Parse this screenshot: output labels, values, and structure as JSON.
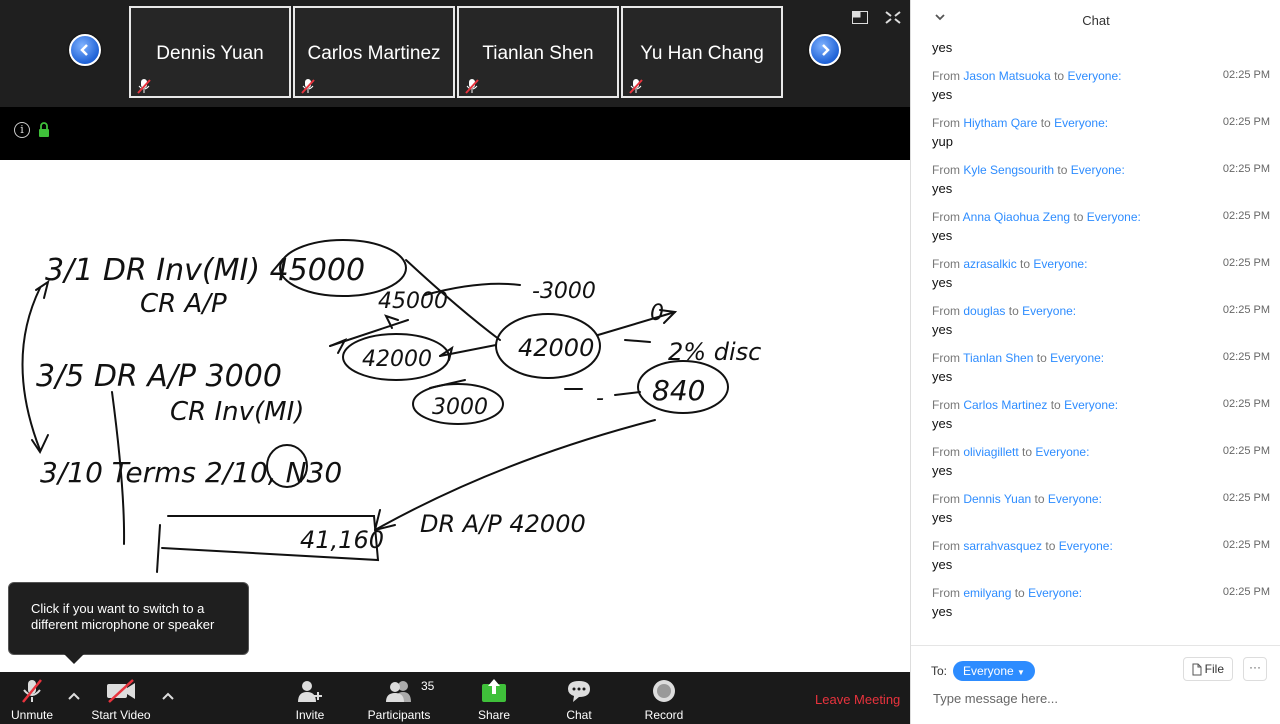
{
  "gallery": {
    "tiles": [
      {
        "name": "Dennis Yuan"
      },
      {
        "name": "Carlos Martinez"
      },
      {
        "name": "Tianlan Shen"
      },
      {
        "name": "Yu Han Chang"
      }
    ]
  },
  "tooltip": {
    "text": "Click if you want to switch to a different microphone or speaker"
  },
  "toolbar": {
    "unmute": "Unmute",
    "start_video": "Start Video",
    "invite": "Invite",
    "participants": "Participants",
    "participants_count": "35",
    "share": "Share",
    "chat": "Chat",
    "record": "Record",
    "leave": "Leave Meeting",
    "colors": {
      "share_green": "#3fc03a",
      "leave_red": "#e8333d",
      "mute_red": "#e8333d"
    }
  },
  "chat": {
    "title": "Chat",
    "first_message": "yes",
    "from_word": "From",
    "to_word": "to",
    "messages": [
      {
        "from": "Jason Matsuoka",
        "to": "Everyone:",
        "time": "02:25 PM",
        "text": "yes"
      },
      {
        "from": "Hiytham Qare",
        "to": "Everyone:",
        "time": "02:25 PM",
        "text": "yup"
      },
      {
        "from": "Kyle Sengsourith",
        "to": "Everyone:",
        "time": "02:25 PM",
        "text": "yes"
      },
      {
        "from": "Anna Qiaohua Zeng",
        "to": "Everyone:",
        "time": "02:25 PM",
        "text": "yes"
      },
      {
        "from": "azrasalkic",
        "to": "Everyone:",
        "time": "02:25 PM",
        "text": "yes"
      },
      {
        "from": "douglas",
        "to": "Everyone:",
        "time": "02:25 PM",
        "text": "yes"
      },
      {
        "from": "Tianlan Shen",
        "to": "Everyone:",
        "time": "02:25 PM",
        "text": "yes"
      },
      {
        "from": "Carlos Martinez",
        "to": "Everyone:",
        "time": "02:25 PM",
        "text": "yes"
      },
      {
        "from": "oliviagillett",
        "to": "Everyone:",
        "time": "02:25 PM",
        "text": "yes"
      },
      {
        "from": "Dennis Yuan",
        "to": "Everyone:",
        "time": "02:25 PM",
        "text": "yes"
      },
      {
        "from": "sarrahvasquez",
        "to": "Everyone:",
        "time": "02:25 PM",
        "text": "yes"
      },
      {
        "from": "emilyang",
        "to": "Everyone:",
        "time": "02:25 PM",
        "text": "yes"
      }
    ],
    "to_label": "To:",
    "recipient": "Everyone",
    "file_label": "File",
    "more_label": "···",
    "input_placeholder": "Type message here..."
  },
  "whiteboard": {
    "lines": [
      "3/1 DR Inv(MI) 45000",
      "CR A/P",
      "45000",
      "-3000",
      "0",
      "42000",
      "42000",
      "2% disc",
      "3/5 DR A/P 3000",
      "CR Inv(MI)",
      "3000",
      "-",
      "840",
      "3/10 Terms 2/10, N30",
      "41,160",
      "DR A/P 42000"
    ]
  },
  "icons": {
    "nav_left": "chevron-left-icon",
    "nav_right": "chevron-right-icon",
    "info": "info-icon",
    "lock": "lock-icon",
    "muted_mic": "muted-mic-icon"
  }
}
